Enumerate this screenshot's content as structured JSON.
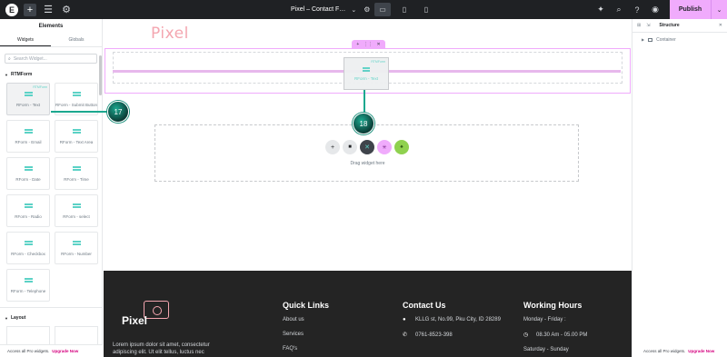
{
  "topbar": {
    "title": "Pixel – Contact F…",
    "publish_label": "Publish"
  },
  "left_panel": {
    "title": "Elements",
    "tabs": [
      "Widgets",
      "Globals"
    ],
    "search_placeholder": "Search Widget...",
    "category": "RTMForm",
    "widgets": [
      {
        "label": "RForm - Text",
        "pro": "RTMForm"
      },
      {
        "label": "RForm - Submit Button"
      },
      {
        "label": "RForm - Email"
      },
      {
        "label": "RForm - Text Area"
      },
      {
        "label": "RForm - Date"
      },
      {
        "label": "RForm - Time"
      },
      {
        "label": "RForm - Radio"
      },
      {
        "label": "RForm - select"
      },
      {
        "label": "RForm - Checkbox"
      },
      {
        "label": "RForm - Number"
      },
      {
        "label": "RForm - Telephone"
      }
    ],
    "layout_category": "Layout",
    "bottom_note": "Access all Pro widgets.",
    "bottom_link": "Upgrade Now"
  },
  "canvas": {
    "site_logo": "Pixel",
    "drag_ghost": {
      "label": "RForm - Text",
      "pro": "RTMForm"
    },
    "drag_here": "Drag widget here"
  },
  "footer": {
    "logo": "Pixel",
    "about": "Lorem ipsum dolor sit amet, consectetur adipiscing elit. Ut elit tellus, luctus nec",
    "quick_links": {
      "title": "Quick Links",
      "items": [
        "About us",
        "Services",
        "FAQ's"
      ]
    },
    "contact": {
      "title": "Contact Us",
      "items": [
        "KLLG st, No.99, Pku City, ID 28289",
        "0761-8523-398"
      ]
    },
    "hours": {
      "title": "Working Hours",
      "items": [
        "Monday - Friday :",
        "08.30 Am - 05.00 PM",
        "Saturday - Sunday"
      ]
    }
  },
  "right_panel": {
    "title": "Structure",
    "tree_item": "Container",
    "bottom_note": "Access all Pro widgets.",
    "bottom_link": "Upgrade Now"
  },
  "markers": [
    "17",
    "18"
  ],
  "colors": {
    "accent": "#f0abfc",
    "widget_icon": "#5cd2c6",
    "marker": "#1ba88f",
    "footer_bg": "#242424"
  }
}
